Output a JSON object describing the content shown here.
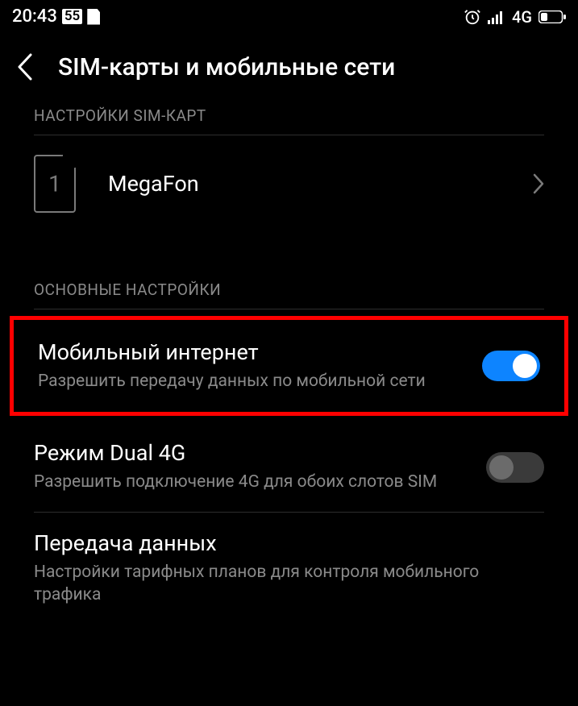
{
  "statusBar": {
    "time": "20:43",
    "badge": "55",
    "netLabel": "4G"
  },
  "header": {
    "title": "SIM-карты и мобильные сети"
  },
  "sections": {
    "simSettings": {
      "header": "НАСТРОЙКИ SIM-КАРТ",
      "sim1": {
        "number": "1",
        "label": "MegaFon"
      }
    },
    "mainSettings": {
      "header": "ОСНОВНЫЕ НАСТРОЙКИ",
      "mobileData": {
        "title": "Мобильный интернет",
        "desc": "Разрешить передачу данных по мобильной сети",
        "enabled": true
      },
      "dual4g": {
        "title": "Режим Dual 4G",
        "desc": "Разрешить подключение 4G для обоих слотов SIM",
        "enabled": false
      },
      "dataUsage": {
        "title": "Передача данных",
        "desc": "Настройки тарифных планов для контроля мобильного трафика"
      }
    }
  }
}
